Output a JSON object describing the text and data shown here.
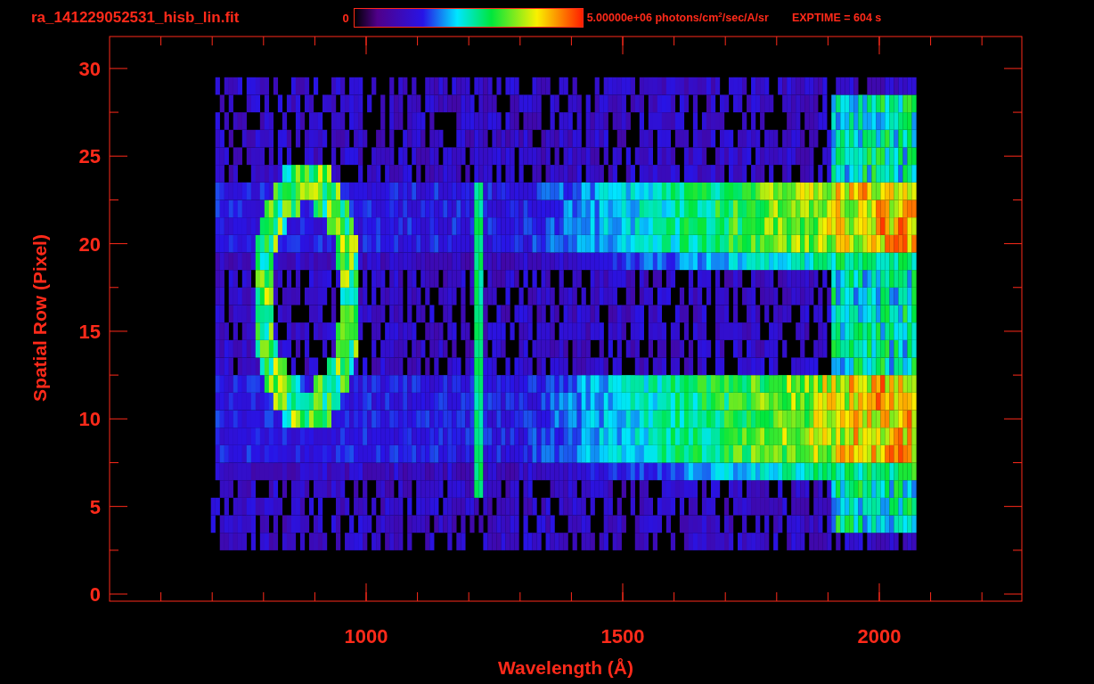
{
  "header": {
    "filename": "ra_141229052531_hisb_lin.fit",
    "colorbar_min": "0",
    "colorbar_max": "5.00000e+06 photons/cm$^{2}$/sec/A/sr",
    "exposure": "EXPTIME = 604 s"
  },
  "x_axis": {
    "label": "Wavelength (Å)",
    "ticks": [
      "1000",
      "1500",
      "2000"
    ]
  },
  "y_axis": {
    "label": "Spatial Row (Pixel)",
    "ticks": [
      "30",
      "25",
      "20",
      "15",
      "10",
      "5",
      "0"
    ]
  }
}
